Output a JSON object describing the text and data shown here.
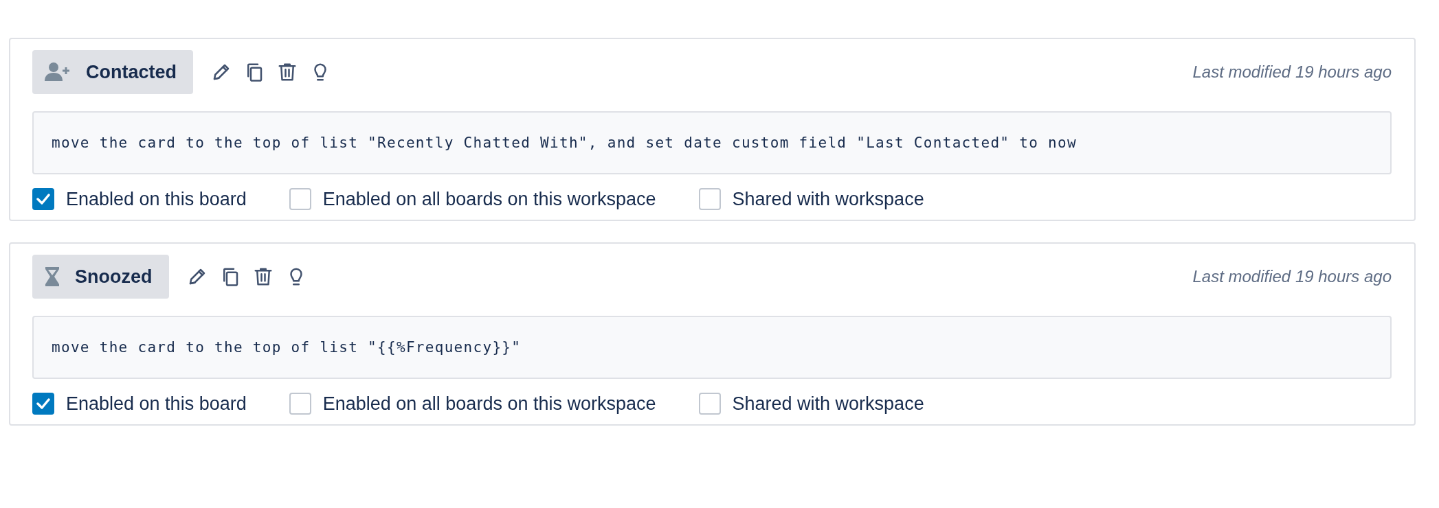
{
  "buttons": [
    {
      "name": "Contacted",
      "kind": "person-plus",
      "modified": "Last modified 19 hours ago",
      "command": "move the card to the top of list \"Recently Chatted With\", and set date custom field \"Last Contacted\" to now",
      "options": [
        {
          "label": "Enabled on this board",
          "checked": true
        },
        {
          "label": "Enabled on all boards on this workspace",
          "checked": false
        },
        {
          "label": "Shared with workspace",
          "checked": false
        }
      ]
    },
    {
      "name": "Snoozed",
      "kind": "hourglass",
      "modified": "Last modified 19 hours ago",
      "command": "move the card to the top of list \"{{%Frequency}}\"",
      "options": [
        {
          "label": "Enabled on this board",
          "checked": true
        },
        {
          "label": "Enabled on all boards on this workspace",
          "checked": false
        },
        {
          "label": "Shared with workspace",
          "checked": false
        }
      ]
    }
  ]
}
